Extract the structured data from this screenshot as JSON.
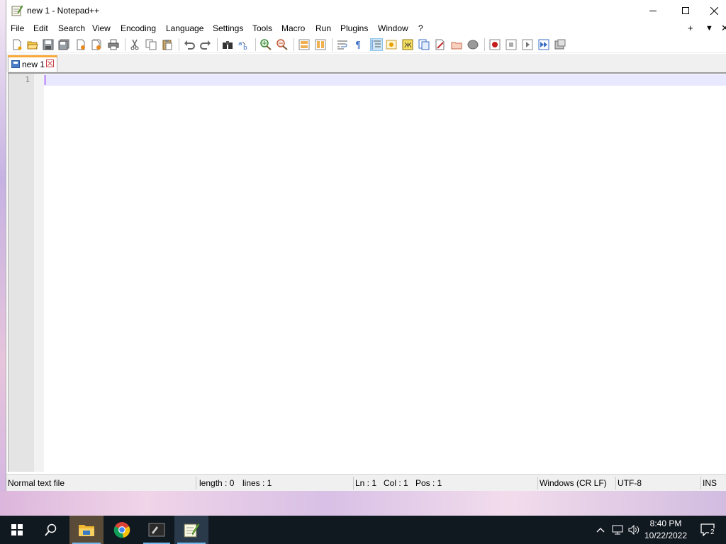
{
  "window": {
    "title": "new 1 - Notepad++"
  },
  "menu": {
    "items": [
      "File",
      "Edit",
      "Search",
      "View",
      "Encoding",
      "Language",
      "Settings",
      "Tools",
      "Macro",
      "Run",
      "Plugins",
      "Window",
      "?"
    ],
    "right_add": "+",
    "right_list": "▼",
    "right_close": "✕"
  },
  "toolbar": {
    "icons": [
      "new-file-icon",
      "open-file-icon",
      "save-icon",
      "save-all-icon",
      "close-icon",
      "close-all-icon",
      "print-icon",
      "cut-icon",
      "copy-icon",
      "paste-icon",
      "undo-icon",
      "redo-icon",
      "find-icon",
      "replace-icon",
      "zoom-in-icon",
      "zoom-out-icon",
      "sync-vertical-icon",
      "sync-horizontal-icon",
      "word-wrap-icon",
      "show-all-characters-icon",
      "indent-guide-icon",
      "user-defined-language-icon",
      "document-map-icon",
      "function-list-icon",
      "folder-as-workspace-icon",
      "document-list-icon",
      "monitoring-icon",
      "record-macro-icon",
      "stop-record-icon",
      "play-macro-icon",
      "run-macro-multiple-icon",
      "save-macro-icon"
    ],
    "active": "indent-guide-icon"
  },
  "tabs": [
    {
      "label": "new 1",
      "active": true
    }
  ],
  "editor": {
    "line_numbers": [
      "1"
    ],
    "content": ""
  },
  "status": {
    "file_type": "Normal text file",
    "length": "length : 0",
    "lines": "lines : 1",
    "ln": "Ln : 1",
    "col": "Col : 1",
    "pos": "Pos : 1",
    "eol": "Windows (CR LF)",
    "encoding": "UTF-8",
    "mode": "INS"
  },
  "taskbar": {
    "apps": [
      "start-icon",
      "search-icon",
      "file-explorer-icon",
      "chrome-icon",
      "terminal-icon",
      "notepadpp-icon"
    ],
    "time": "8:40 PM",
    "date": "10/22/2022",
    "notification_count": "2"
  },
  "colors": {
    "tab_accent": "#fba83a",
    "caret": "#8000ff",
    "current_line": "#e8e8ff",
    "taskbar": "#101820"
  }
}
